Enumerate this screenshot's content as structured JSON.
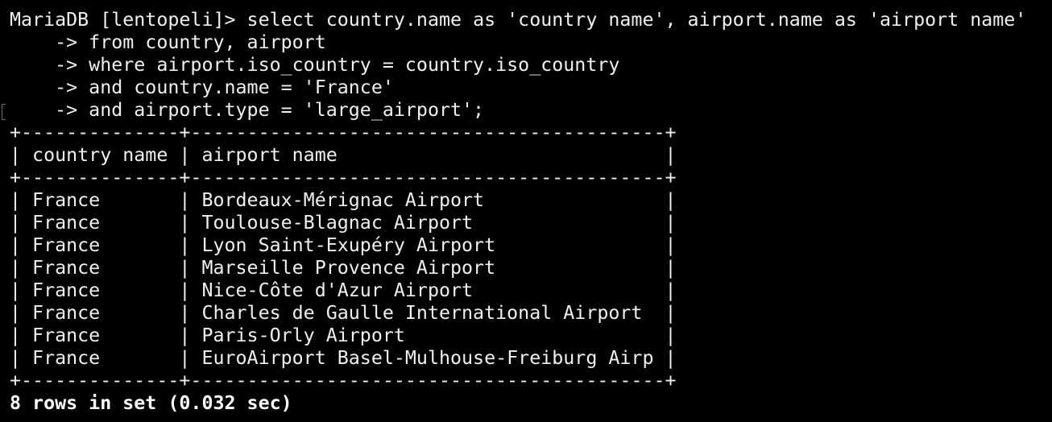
{
  "terminal": {
    "prompt": "MariaDB [lentopeli]> ",
    "query_lines": [
      "select country.name as 'country name', airport.name as 'airport name'",
      "    -> from country, airport",
      "    -> where airport.iso_country = country.iso_country",
      "    -> and country.name = 'France'",
      "    -> and airport.type = 'large_airport';"
    ],
    "table": {
      "border": "+--------------+------------------------------------------+",
      "header": "| country name | airport name                             |",
      "rows": [
        "| France       | Bordeaux-Mérignac Airport                |",
        "| France       | Toulouse-Blagnac Airport                 |",
        "| France       | Lyon Saint-Exupéry Airport               |",
        "| France       | Marseille Provence Airport               |",
        "| France       | Nice-Côte d'Azur Airport                 |",
        "| France       | Charles de Gaulle International Airport  |",
        "| France       | Paris-Orly Airport                       |",
        "| France       | EuroAirport Basel-Mulhouse-Freiburg Airp |"
      ]
    },
    "summary": "8 rows in set (0.032 sec)"
  }
}
